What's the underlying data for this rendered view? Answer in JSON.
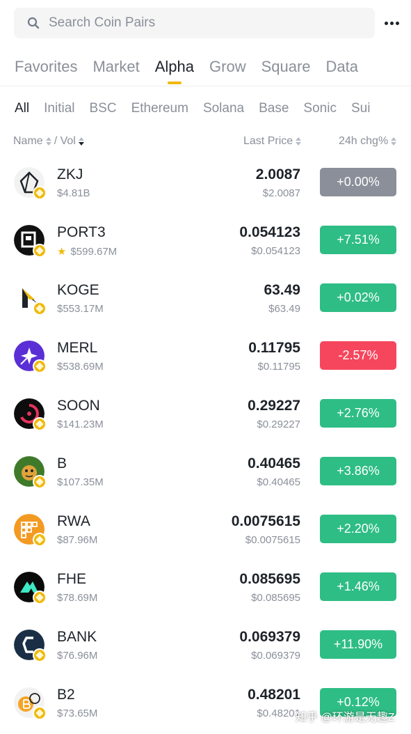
{
  "search": {
    "placeholder": "Search Coin Pairs"
  },
  "main_tabs": [
    {
      "label": "Favorites",
      "active": false
    },
    {
      "label": "Market",
      "active": false
    },
    {
      "label": "Alpha",
      "active": true
    },
    {
      "label": "Grow",
      "active": false
    },
    {
      "label": "Square",
      "active": false
    },
    {
      "label": "Data",
      "active": false
    }
  ],
  "chain_tabs": [
    {
      "label": "All",
      "active": true
    },
    {
      "label": "Initial",
      "active": false
    },
    {
      "label": "BSC",
      "active": false
    },
    {
      "label": "Ethereum",
      "active": false
    },
    {
      "label": "Solana",
      "active": false
    },
    {
      "label": "Base",
      "active": false
    },
    {
      "label": "Sonic",
      "active": false
    },
    {
      "label": "Sui",
      "active": false
    }
  ],
  "columns": {
    "name": "Name",
    "vol": "/ Vol",
    "price": "Last Price",
    "change": "24h chg%"
  },
  "colors": {
    "up": "#2ebd85",
    "down": "#f6465d",
    "flat": "#8a8f99",
    "accent": "#f0b90b"
  },
  "rows": [
    {
      "symbol": "ZKJ",
      "volume": "$4.81B",
      "price": "2.0087",
      "price_usd": "$2.0087",
      "change": "+0.00%",
      "trend": "flat",
      "favorite": false,
      "icon": "zkj-logo-icon"
    },
    {
      "symbol": "PORT3",
      "volume": "$599.67M",
      "price": "0.054123",
      "price_usd": "$0.054123",
      "change": "+7.51%",
      "trend": "up",
      "favorite": true,
      "icon": "port3-logo-icon"
    },
    {
      "symbol": "KOGE",
      "volume": "$553.17M",
      "price": "63.49",
      "price_usd": "$63.49",
      "change": "+0.02%",
      "trend": "up",
      "favorite": false,
      "icon": "koge-logo-icon"
    },
    {
      "symbol": "MERL",
      "volume": "$538.69M",
      "price": "0.11795",
      "price_usd": "$0.11795",
      "change": "-2.57%",
      "trend": "down",
      "favorite": false,
      "icon": "merl-logo-icon"
    },
    {
      "symbol": "SOON",
      "volume": "$141.23M",
      "price": "0.29227",
      "price_usd": "$0.29227",
      "change": "+2.76%",
      "trend": "up",
      "favorite": false,
      "icon": "soon-logo-icon"
    },
    {
      "symbol": "B",
      "volume": "$107.35M",
      "price": "0.40465",
      "price_usd": "$0.40465",
      "change": "+3.86%",
      "trend": "up",
      "favorite": false,
      "icon": "b-logo-icon"
    },
    {
      "symbol": "RWA",
      "volume": "$87.96M",
      "price": "0.0075615",
      "price_usd": "$0.0075615",
      "change": "+2.20%",
      "trend": "up",
      "favorite": false,
      "icon": "rwa-logo-icon"
    },
    {
      "symbol": "FHE",
      "volume": "$78.69M",
      "price": "0.085695",
      "price_usd": "$0.085695",
      "change": "+1.46%",
      "trend": "up",
      "favorite": false,
      "icon": "fhe-logo-icon"
    },
    {
      "symbol": "BANK",
      "volume": "$76.96M",
      "price": "0.069379",
      "price_usd": "$0.069379",
      "change": "+11.90%",
      "trend": "up",
      "favorite": false,
      "icon": "bank-logo-icon"
    },
    {
      "symbol": "B2",
      "volume": "$73.65M",
      "price": "0.48201",
      "price_usd": "$0.48201",
      "change": "+0.12%",
      "trend": "up",
      "favorite": false,
      "icon": "b2-logo-icon"
    }
  ],
  "watermark": "知乎 @环游是无趣Z"
}
